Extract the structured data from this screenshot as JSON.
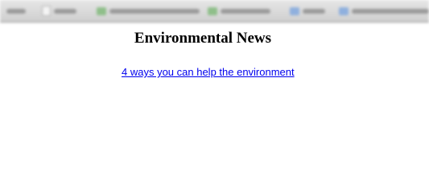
{
  "page": {
    "heading": "Environmental News",
    "link_text": "4 ways you can help the environment"
  },
  "toolbar": {
    "bookmarks": [
      {
        "icon": "blank-favicon-icon"
      },
      {
        "icon": "page-icon"
      },
      {
        "icon": "green-favicon-icon"
      },
      {
        "icon": "green-favicon-icon"
      },
      {
        "icon": "folder-icon"
      },
      {
        "icon": "folder-icon"
      }
    ]
  },
  "colors": {
    "link": "#0000ee",
    "heading": "#000000",
    "background": "#ffffff"
  }
}
